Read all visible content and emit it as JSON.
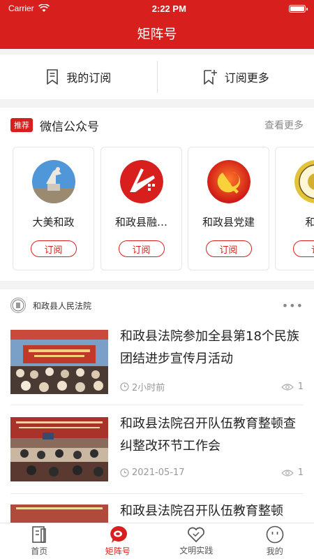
{
  "status": {
    "carrier": "Carrier",
    "time": "2:22 PM"
  },
  "nav": {
    "title": "矩阵号"
  },
  "subscribe_row": {
    "my_subs": "我的订阅",
    "more_subs": "订阅更多"
  },
  "wechat": {
    "badge": "推荐",
    "title": "微信公众号",
    "more": "查看更多",
    "cards": [
      {
        "name": "大美和政",
        "button": "订阅"
      },
      {
        "name": "和政县融…",
        "button": "订阅"
      },
      {
        "name": "和政县党建",
        "button": "订阅"
      },
      {
        "name": "和政",
        "button": "订"
      }
    ]
  },
  "feed": {
    "source_name": "和政县人民法院",
    "articles": [
      {
        "title": "和政县法院参加全县第18个民族团结进步宣传月活动",
        "time": "2小时前",
        "views": "1"
      },
      {
        "title": "和政县法院召开队伍教育整顿查纠整改环节工作会",
        "time": "2021-05-17",
        "views": "1"
      },
      {
        "title": "和政县法院召开队伍教育整顿",
        "time": "",
        "views": ""
      }
    ]
  },
  "tabs": [
    {
      "label": "首页",
      "icon": "home-doc-icon"
    },
    {
      "label": "矩阵号",
      "icon": "matrix-pin-icon"
    },
    {
      "label": "文明实践",
      "icon": "heart-icon"
    },
    {
      "label": "我的",
      "icon": "smiley-icon"
    }
  ],
  "colors": {
    "brand": "#d7201d",
    "background": "#f3f3f3"
  }
}
